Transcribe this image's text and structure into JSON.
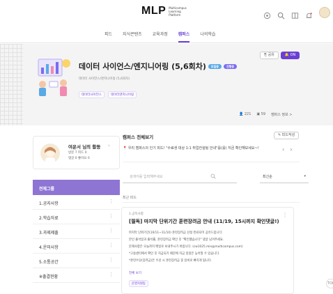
{
  "brand": {
    "logo": "MLP",
    "sub_line1": "Multicampus",
    "sub_line2": "Learning Platform"
  },
  "nav": {
    "tabs": [
      "피드",
      "지식콘텐츠",
      "교육과정",
      "캠퍼스",
      "나의학습"
    ],
    "active_index": 3
  },
  "hero": {
    "title": "데이터 사이언스/엔지니어링 (5,6회차)",
    "badge1": "모집중",
    "badge2": "진행중",
    "subtitle": "데이터 사이언스/엔지니어링 (5,6회차)",
    "subtitle2": "",
    "tags": [
      "데이터사이언스",
      "데이터엔지니어링"
    ],
    "btn_share": "공유",
    "btn_on": "ON",
    "stats": [
      "221",
      "59",
      "캠퍼스 정보 >"
    ]
  },
  "profile": {
    "name": "여운서 님의 활동",
    "stats_row1": "방문 7     피드 0",
    "stats_row2": "댓글 0     좋아요 0"
  },
  "menu": {
    "header": "전체그룹",
    "items": [
      "1.공지사항",
      "2.학습자료",
      "3.과제제출",
      "4.운미사항",
      "5.소통공간",
      "※출결현황"
    ]
  },
  "campus": {
    "section_title": "캠퍼스 전체보기",
    "write_btn": "피드작성",
    "notice": "우리 캠퍼스의 인기 피드! \"수료생 대상 1:1 취업컨설팅 안내\"를(를) 지금 확인해보세요~!",
    "search_placeholder": "검색어를 입력해주세요",
    "sort_value": "최신순",
    "latest_label": "최근 피드"
  },
  "post": {
    "small": "1.공지사항",
    "title": "[필독] 마지막 단위기간 훈련장려금 안내 (11/19, 15시까지 확인댓글!)",
    "lines": [
      "마지막 단위기간(10/11~11/10) 훈련장려금 산정 완료되어 공유드립니다.",
      "본인 출석일과 출석률, 훈련장려금 확인 후 \"확인했습니다\" 댓글 남겨주세요.",
      "문제사항은 오늘까지 메일로 보내주시기 바랍니다. (cw1025.min@multicampus.com)",
      "*고용센터에서 확인 후 지급되기 때문에 지급 일정은 늦어질 수 있습니다.",
      "*훈련수당(장려금)은 수강 시 훈련장려금 중 탕비로 빠지게 됩니다."
    ],
    "more": "전체 보기",
    "tag": "운영지원팀"
  },
  "float_btn": "TOP"
}
